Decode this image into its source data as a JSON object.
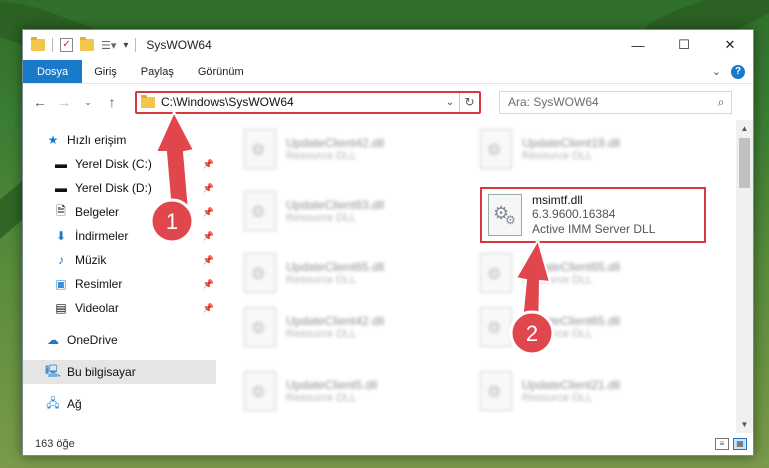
{
  "window": {
    "title": "SysWOW64"
  },
  "ribbon": {
    "tabs": [
      "Dosya",
      "Giriş",
      "Paylaş",
      "Görünüm"
    ],
    "help_label": "?"
  },
  "address": {
    "path": "C:\\Windows\\SysWOW64",
    "search_placeholder": "Ara: SysWOW64"
  },
  "nav": {
    "quick_access": "Hızlı erişim",
    "items": [
      "Yerel Disk (C:)",
      "Yerel Disk (D:)",
      "Belgeler",
      "İndirmeler",
      "Müzik",
      "Resimler",
      "Videolar"
    ],
    "onedrive": "OneDrive",
    "this_pc": "Bu bilgisayar",
    "network": "Ağ"
  },
  "files": {
    "blurred": [
      {
        "name": "UpdateClient42.dll",
        "type": "Resource DLL"
      },
      {
        "name": "UpdateClient19.dll",
        "type": "Resource DLL"
      },
      {
        "name": "UpdateClient63.dll",
        "type": "Resource DLL"
      },
      {
        "name": "UpdateClient65.dll",
        "type": "Resource DLL"
      },
      {
        "name": "UpdateClient65.dll",
        "type": "Resource DLL"
      },
      {
        "name": "UpdateClient42.dll",
        "type": "Resource DLL"
      },
      {
        "name": "UpdateClient65.dll",
        "type": "Resource DLL"
      },
      {
        "name": "UpdateClient5.dll",
        "type": "Resource DLL"
      },
      {
        "name": "UpdateClient21.dll",
        "type": "Resource DLL"
      }
    ],
    "highlighted": {
      "name": "msimtf.dll",
      "version": "6.3.9600.16384",
      "description": "Active IMM Server DLL"
    }
  },
  "status": {
    "count": "163 öğe"
  },
  "callouts": {
    "one": "1",
    "two": "2"
  },
  "colors": {
    "accent": "#1979ca",
    "highlight": "#d9363e"
  }
}
